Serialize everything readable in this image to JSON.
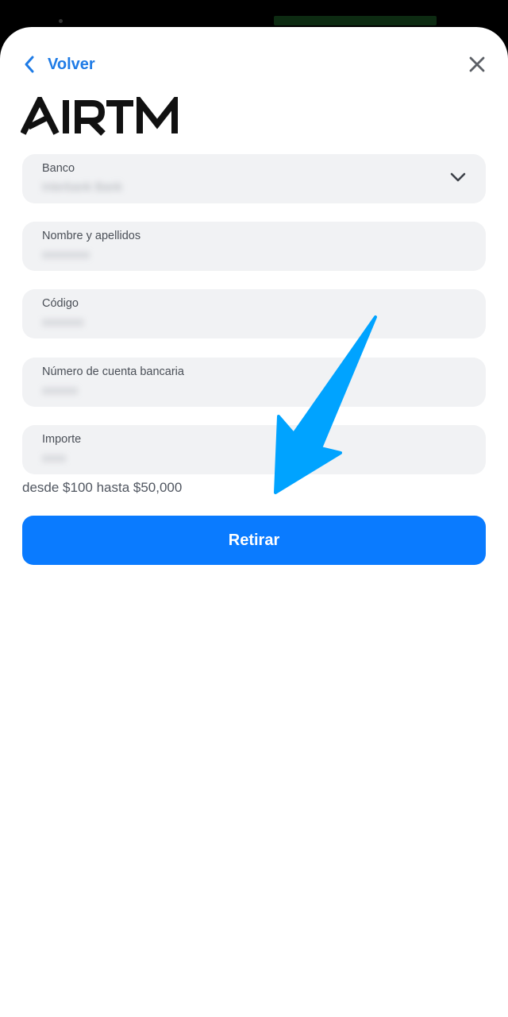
{
  "header": {
    "back_label": "Volver",
    "logo_text": "AIRTM"
  },
  "form": {
    "fields": [
      {
        "label": "Banco",
        "value": "Interbank Bank",
        "has_dropdown": true
      },
      {
        "label": "Nombre y apellidos",
        "value": "xxxxxxxx"
      },
      {
        "label": "Código",
        "value": "xxxxxxx"
      },
      {
        "label": "Número de cuenta bancaria",
        "value": "xxxxxx"
      },
      {
        "label": "Importe",
        "value": "xxxx"
      }
    ],
    "hint": "desde $100 hasta $50,000",
    "submit_label": "Retirar"
  },
  "colors": {
    "accent": "#0a7bff",
    "link": "#1e7be6",
    "field_bg": "#f1f2f4",
    "annotation_arrow": "#00a3ff"
  },
  "icons": [
    "chevron-left-icon",
    "close-icon",
    "chevron-down-icon",
    "annotation-arrow-icon"
  ]
}
